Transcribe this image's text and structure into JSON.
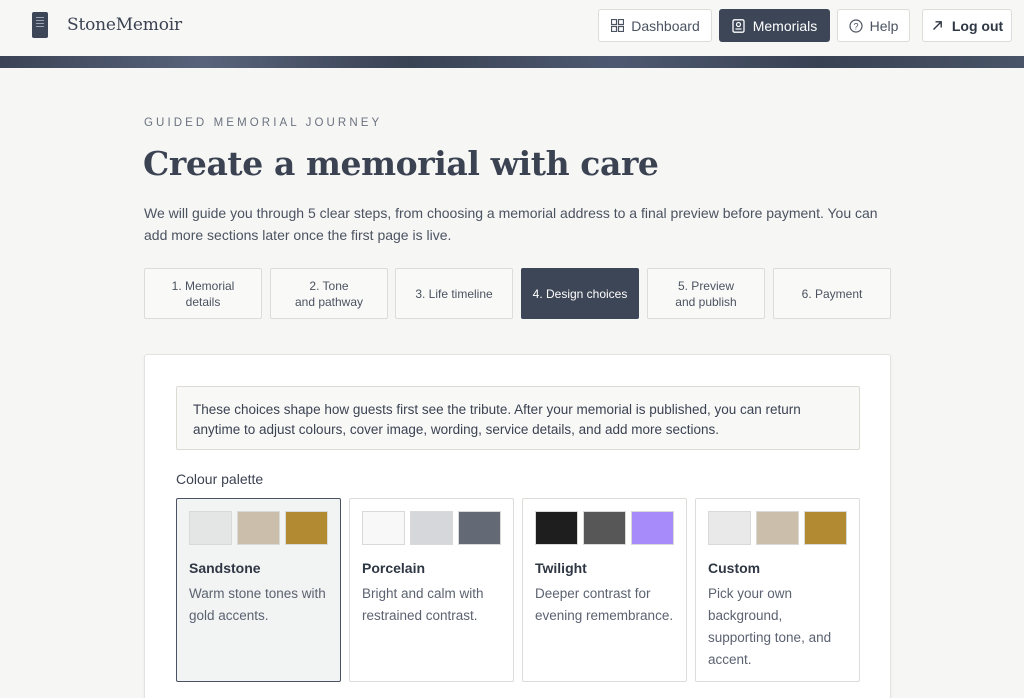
{
  "brand": {
    "name": "StoneMemoir"
  },
  "nav": {
    "dashboard": "Dashboard",
    "memorials": "Memorials",
    "help": "Help",
    "logout": "Log out"
  },
  "hero": {
    "eyebrow": "GUIDED MEMORIAL JOURNEY",
    "title": "Create a memorial with care",
    "intro": "We will guide you through 5 clear steps, from choosing a memorial address to a final preview before payment. You can add more sections later once the first page is live."
  },
  "steps": [
    {
      "label": "1. Memorial\ndetails",
      "active": false
    },
    {
      "label": "2. Tone\nand pathway",
      "active": false
    },
    {
      "label": "3. Life timeline",
      "active": false
    },
    {
      "label": "4. Design choices",
      "active": true
    },
    {
      "label": "5. Preview\nand publish",
      "active": false
    },
    {
      "label": "6. Payment",
      "active": false
    }
  ],
  "design": {
    "notice": "These choices shape how guests first see the tribute. After your memorial is published, you can return anytime to adjust colours, cover image, wording, service details, and add more sections.",
    "palette_label": "Colour palette",
    "palettes": [
      {
        "name": "Sandstone",
        "description": "Warm stone tones with gold accents.",
        "selected": true,
        "colors": [
          "#e4e5e5",
          "#cbbfac",
          "#b28a32"
        ]
      },
      {
        "name": "Porcelain",
        "description": "Bright and calm with restrained contrast.",
        "selected": false,
        "colors": [
          "#f8f8f8",
          "#d6d7da",
          "#646a75"
        ]
      },
      {
        "name": "Twilight",
        "description": "Deeper contrast for evening remembrance.",
        "selected": false,
        "colors": [
          "#1e1e1e",
          "#575757",
          "#a78bfa"
        ]
      },
      {
        "name": "Custom",
        "description": "Pick your own background, supporting tone, and accent.",
        "selected": false,
        "colors": [
          "#e9e9ea",
          "#cbbfac",
          "#b28a32"
        ]
      }
    ]
  }
}
